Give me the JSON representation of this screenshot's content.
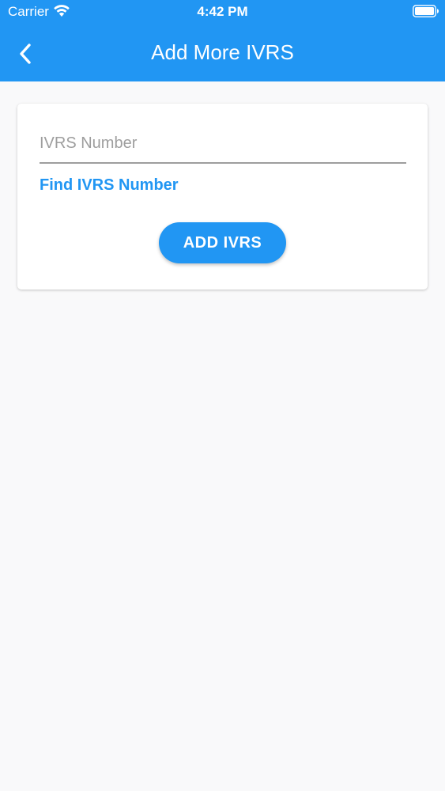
{
  "status_bar": {
    "carrier": "Carrier",
    "time": "4:42 PM",
    "wifi_icon": "wifi-icon",
    "battery_icon": "battery-icon"
  },
  "nav": {
    "title": "Add More IVRS",
    "back_icon": "chevron-left-icon"
  },
  "form": {
    "ivrs_placeholder": "IVRS Number",
    "ivrs_value": "",
    "find_link": "Find IVRS Number",
    "add_button": "ADD IVRS"
  },
  "colors": {
    "primary": "#2196f3",
    "background": "#f9f9fa",
    "card": "#ffffff",
    "placeholder": "#9e9e9e"
  }
}
